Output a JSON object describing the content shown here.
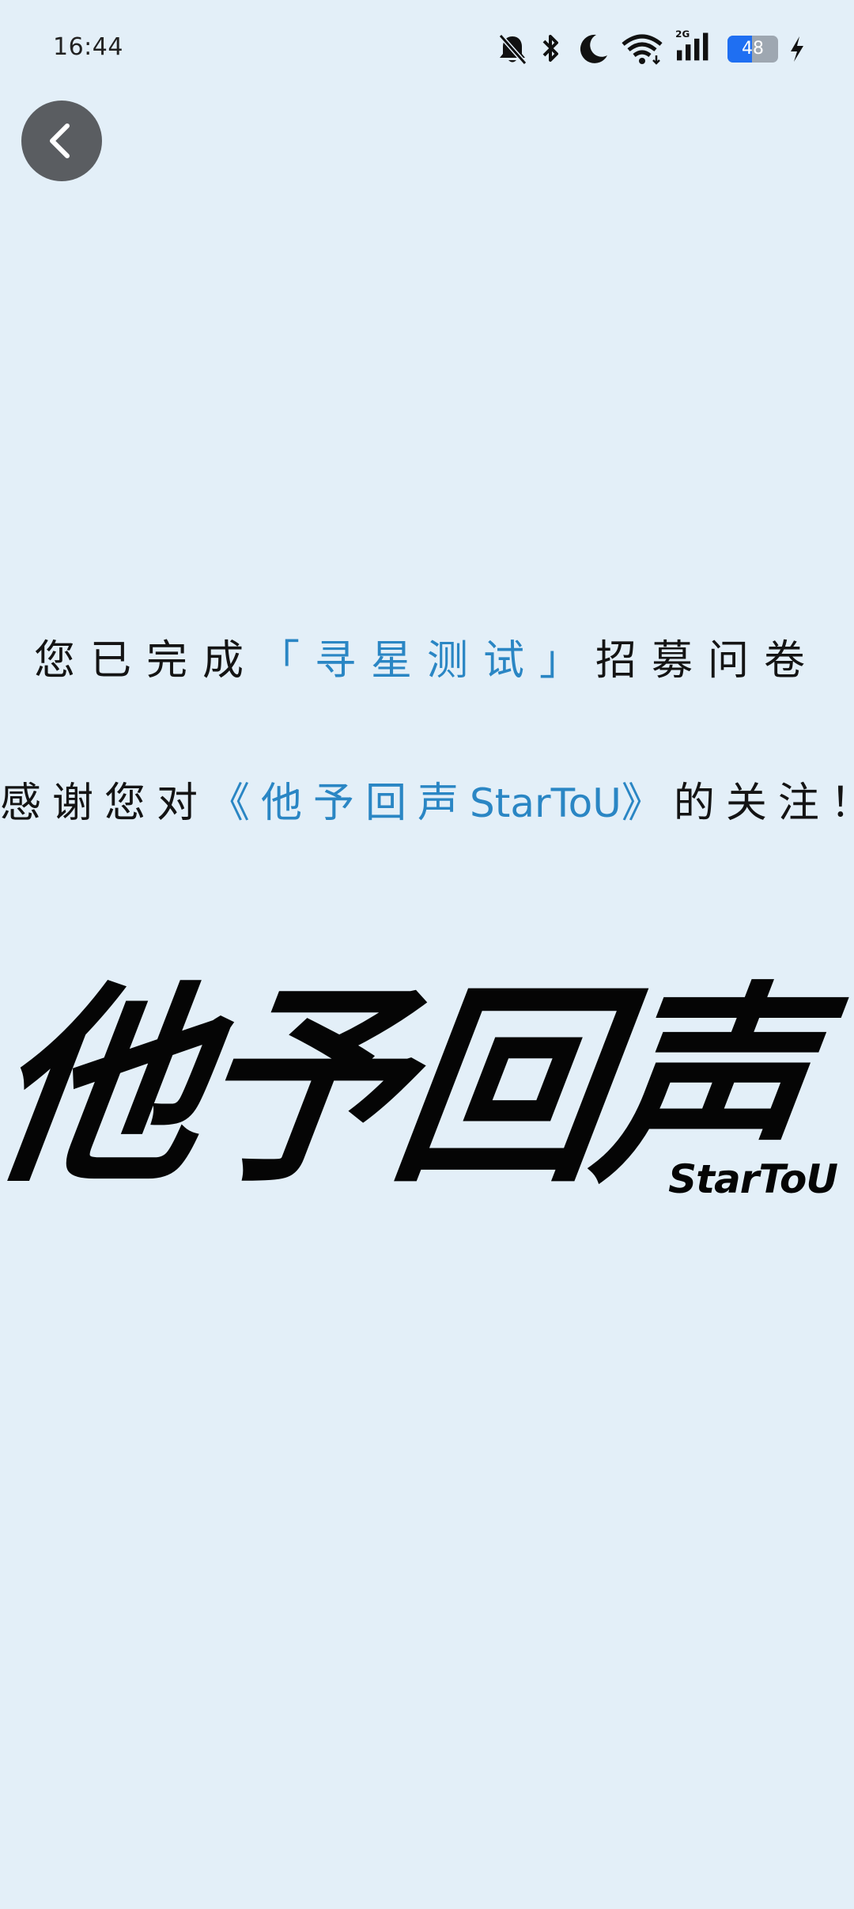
{
  "status_bar": {
    "time": "16:44",
    "battery_level": "48",
    "icons": [
      "bell-off-icon",
      "bluetooth-icon",
      "moon-icon",
      "wifi-icon",
      "signal-2g-icon",
      "battery-icon",
      "charging-icon"
    ],
    "network_label": "2G"
  },
  "nav": {
    "back_icon": "chevron-left-icon"
  },
  "message": {
    "line1_prefix": "您已完成",
    "line1_highlight": "「寻星测试」",
    "line1_suffix": "招募问卷",
    "line2_prefix": "感谢您对",
    "line2_open": "《他予回声",
    "line2_en": "StarToU",
    "line2_close": "》",
    "line2_suffix": "的关注！"
  },
  "logo": {
    "main_text": "他予回声",
    "sub_text": "StarToU"
  },
  "colors": {
    "background": "#e3eff8",
    "highlight": "#2a86c4",
    "text": "#141414",
    "battery_fill": "#1f6ff2",
    "back_button": "#5a5d61"
  }
}
